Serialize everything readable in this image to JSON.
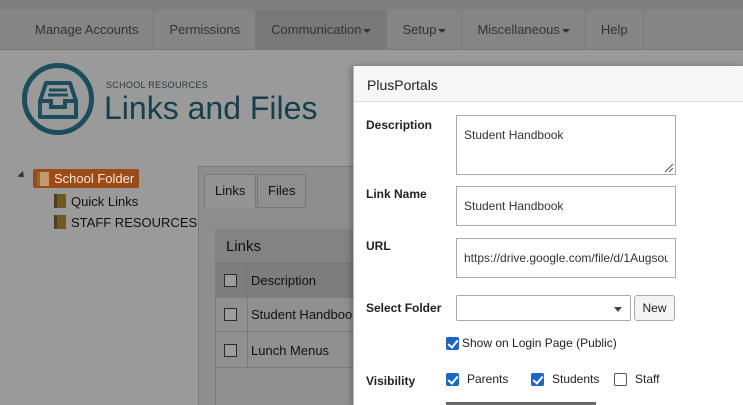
{
  "nav": {
    "items": [
      {
        "label": "Manage Accounts",
        "dropdown": false
      },
      {
        "label": "Permissions",
        "dropdown": false
      },
      {
        "label": "Communication",
        "dropdown": true,
        "active": true
      },
      {
        "label": "Setup",
        "dropdown": true
      },
      {
        "label": "Miscellaneous",
        "dropdown": true
      },
      {
        "label": "Help",
        "dropdown": false
      }
    ]
  },
  "header": {
    "subtitle": "SCHOOL RESOURCES",
    "title": "Links and Files",
    "icon": "inbox-tray-icon"
  },
  "tree": {
    "root": "School Folder",
    "children": [
      "Quick Links",
      "STAFF RESOURCES"
    ]
  },
  "panel": {
    "tabs": [
      "Links",
      "Files"
    ],
    "grid_title": "Links",
    "column_header": "Description",
    "rows": [
      "Student Handbook",
      "Lunch Menus"
    ]
  },
  "modal": {
    "title": "PlusPortals",
    "description_label": "Description",
    "description_value": "Student Handbook",
    "link_name_label": "Link Name",
    "link_name_value": "Student Handbook",
    "url_label": "URL",
    "url_value": "https://drive.google.com/file/d/1Augsou",
    "select_folder_label": "Select Folder",
    "select_folder_value": "",
    "new_button": "New",
    "show_on_login_label": "Show on Login Page (Public)",
    "show_on_login_checked": true,
    "visibility_label": "Visibility",
    "visibility": [
      {
        "label": "Parents",
        "checked": true
      },
      {
        "label": "Students",
        "checked": true
      },
      {
        "label": "Staff",
        "checked": false
      }
    ]
  },
  "colors": {
    "accent_blue": "#1d66c7",
    "brand_teal": "#163f4c",
    "folder_selected": "#9c4a17"
  }
}
